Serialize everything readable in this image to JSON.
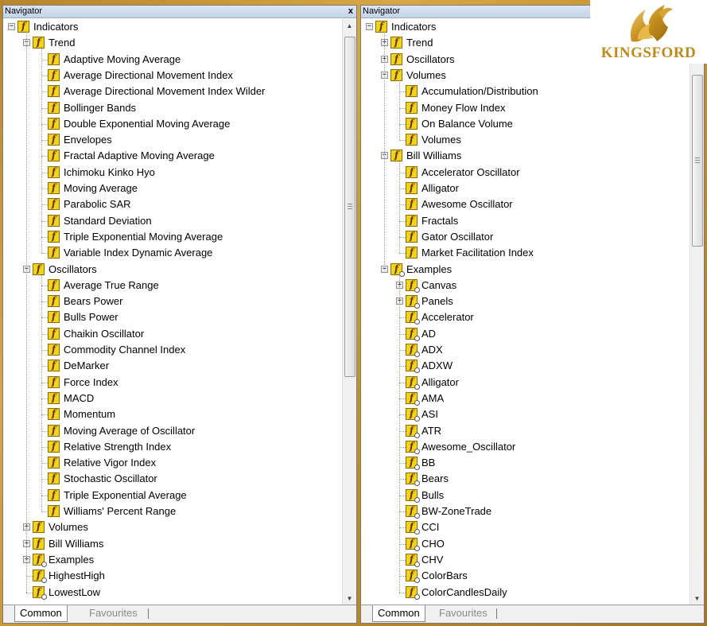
{
  "left_panel": {
    "title": "Navigator",
    "close": "x",
    "tabs": {
      "active": "Common",
      "inactive": "Favourites"
    },
    "items": [
      {
        "label": "Indicators",
        "depth": 0,
        "exp": "minus",
        "icon": "function-icon"
      },
      {
        "label": "Trend",
        "depth": 1,
        "exp": "minus",
        "icon": "function-icon"
      },
      {
        "label": "Adaptive Moving Average",
        "depth": 2,
        "icon": "function-icon"
      },
      {
        "label": "Average Directional Movement Index",
        "depth": 2,
        "icon": "function-icon"
      },
      {
        "label": "Average Directional Movement Index Wilder",
        "depth": 2,
        "icon": "function-icon"
      },
      {
        "label": "Bollinger Bands",
        "depth": 2,
        "icon": "function-icon"
      },
      {
        "label": "Double Exponential Moving Average",
        "depth": 2,
        "icon": "function-icon"
      },
      {
        "label": "Envelopes",
        "depth": 2,
        "icon": "function-icon"
      },
      {
        "label": "Fractal Adaptive Moving Average",
        "depth": 2,
        "icon": "function-icon"
      },
      {
        "label": "Ichimoku Kinko Hyo",
        "depth": 2,
        "icon": "function-icon"
      },
      {
        "label": "Moving Average",
        "depth": 2,
        "icon": "function-icon"
      },
      {
        "label": "Parabolic SAR",
        "depth": 2,
        "icon": "function-icon"
      },
      {
        "label": "Standard Deviation",
        "depth": 2,
        "icon": "function-icon"
      },
      {
        "label": "Triple Exponential Moving Average",
        "depth": 2,
        "icon": "function-icon"
      },
      {
        "label": "Variable Index Dynamic Average",
        "depth": 2,
        "icon": "function-icon"
      },
      {
        "label": "Oscillators",
        "depth": 1,
        "exp": "minus",
        "icon": "function-icon"
      },
      {
        "label": "Average True Range",
        "depth": 2,
        "icon": "function-icon"
      },
      {
        "label": "Bears Power",
        "depth": 2,
        "icon": "function-icon"
      },
      {
        "label": "Bulls Power",
        "depth": 2,
        "icon": "function-icon"
      },
      {
        "label": "Chaikin Oscillator",
        "depth": 2,
        "icon": "function-icon"
      },
      {
        "label": "Commodity Channel Index",
        "depth": 2,
        "icon": "function-icon"
      },
      {
        "label": "DeMarker",
        "depth": 2,
        "icon": "function-icon"
      },
      {
        "label": "Force Index",
        "depth": 2,
        "icon": "function-icon"
      },
      {
        "label": "MACD",
        "depth": 2,
        "icon": "function-icon"
      },
      {
        "label": "Momentum",
        "depth": 2,
        "icon": "function-icon"
      },
      {
        "label": "Moving Average of Oscillator",
        "depth": 2,
        "icon": "function-icon"
      },
      {
        "label": "Relative Strength Index",
        "depth": 2,
        "icon": "function-icon"
      },
      {
        "label": "Relative Vigor Index",
        "depth": 2,
        "icon": "function-icon"
      },
      {
        "label": "Stochastic Oscillator",
        "depth": 2,
        "icon": "function-icon"
      },
      {
        "label": "Triple Exponential Average",
        "depth": 2,
        "icon": "function-icon"
      },
      {
        "label": "Williams' Percent Range",
        "depth": 2,
        "icon": "function-icon"
      },
      {
        "label": "Volumes",
        "depth": 1,
        "exp": "plus",
        "icon": "function-icon"
      },
      {
        "label": "Bill Williams",
        "depth": 1,
        "exp": "plus",
        "icon": "function-icon"
      },
      {
        "label": "Examples",
        "depth": 1,
        "exp": "plus",
        "icon": "custom-function-icon"
      },
      {
        "label": "HighestHigh",
        "depth": 1,
        "icon": "custom-function-icon"
      },
      {
        "label": "LowestLow",
        "depth": 1,
        "icon": "custom-function-icon"
      }
    ]
  },
  "right_panel": {
    "title": "Navigator",
    "tabs": {
      "active": "Common",
      "inactive": "Favourites"
    },
    "items": [
      {
        "label": "Indicators",
        "depth": 0,
        "exp": "minus",
        "icon": "function-icon"
      },
      {
        "label": "Trend",
        "depth": 1,
        "exp": "plus",
        "icon": "function-icon"
      },
      {
        "label": "Oscillators",
        "depth": 1,
        "exp": "plus",
        "icon": "function-icon"
      },
      {
        "label": "Volumes",
        "depth": 1,
        "exp": "minus",
        "icon": "function-icon"
      },
      {
        "label": "Accumulation/Distribution",
        "depth": 2,
        "icon": "function-icon"
      },
      {
        "label": "Money Flow Index",
        "depth": 2,
        "icon": "function-icon"
      },
      {
        "label": "On Balance Volume",
        "depth": 2,
        "icon": "function-icon"
      },
      {
        "label": "Volumes",
        "depth": 2,
        "icon": "function-icon"
      },
      {
        "label": "Bill Williams",
        "depth": 1,
        "exp": "minus",
        "icon": "function-icon"
      },
      {
        "label": "Accelerator Oscillator",
        "depth": 2,
        "icon": "function-icon"
      },
      {
        "label": "Alligator",
        "depth": 2,
        "icon": "function-icon"
      },
      {
        "label": "Awesome Oscillator",
        "depth": 2,
        "icon": "function-icon"
      },
      {
        "label": "Fractals",
        "depth": 2,
        "icon": "function-icon"
      },
      {
        "label": "Gator Oscillator",
        "depth": 2,
        "icon": "function-icon"
      },
      {
        "label": "Market Facilitation Index",
        "depth": 2,
        "icon": "function-icon"
      },
      {
        "label": "Examples",
        "depth": 1,
        "exp": "minus",
        "icon": "custom-function-icon"
      },
      {
        "label": "Canvas",
        "depth": 2,
        "exp": "plus",
        "icon": "custom-function-icon"
      },
      {
        "label": "Panels",
        "depth": 2,
        "exp": "plus",
        "icon": "custom-function-icon"
      },
      {
        "label": "Accelerator",
        "depth": 2,
        "icon": "custom-function-icon"
      },
      {
        "label": "AD",
        "depth": 2,
        "icon": "custom-function-icon"
      },
      {
        "label": "ADX",
        "depth": 2,
        "icon": "custom-function-icon"
      },
      {
        "label": "ADXW",
        "depth": 2,
        "icon": "custom-function-icon"
      },
      {
        "label": "Alligator",
        "depth": 2,
        "icon": "custom-function-icon"
      },
      {
        "label": "AMA",
        "depth": 2,
        "icon": "custom-function-icon"
      },
      {
        "label": "ASI",
        "depth": 2,
        "icon": "custom-function-icon"
      },
      {
        "label": "ATR",
        "depth": 2,
        "icon": "custom-function-icon"
      },
      {
        "label": "Awesome_Oscillator",
        "depth": 2,
        "icon": "custom-function-icon"
      },
      {
        "label": "BB",
        "depth": 2,
        "icon": "custom-function-icon"
      },
      {
        "label": "Bears",
        "depth": 2,
        "icon": "custom-function-icon"
      },
      {
        "label": "Bulls",
        "depth": 2,
        "icon": "custom-function-icon"
      },
      {
        "label": "BW-ZoneTrade",
        "depth": 2,
        "icon": "custom-function-icon"
      },
      {
        "label": "CCI",
        "depth": 2,
        "icon": "custom-function-icon"
      },
      {
        "label": "CHO",
        "depth": 2,
        "icon": "custom-function-icon"
      },
      {
        "label": "CHV",
        "depth": 2,
        "icon": "custom-function-icon"
      },
      {
        "label": "ColorBars",
        "depth": 2,
        "icon": "custom-function-icon"
      },
      {
        "label": "ColorCandlesDaily",
        "depth": 2,
        "icon": "custom-function-icon"
      }
    ]
  },
  "branding": {
    "name": "KINGSFORD",
    "color": "#c08a18"
  },
  "colors": {
    "background": "#c79a35",
    "icon_fill": "#f5d21c"
  }
}
